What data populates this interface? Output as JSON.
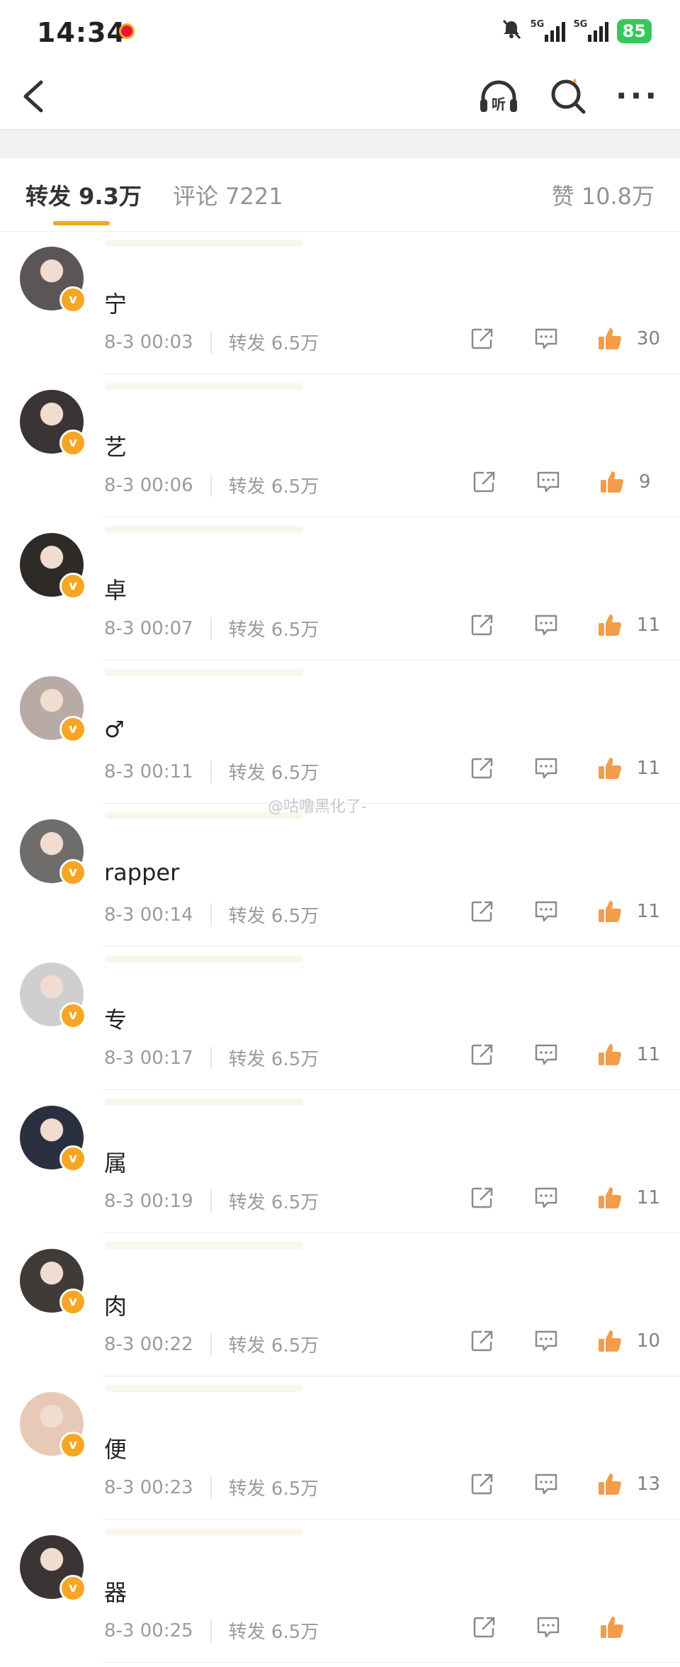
{
  "status": {
    "time": "14:34",
    "network1": "5G",
    "network2": "5G",
    "battery": "85"
  },
  "nav": {
    "listen_label": "听"
  },
  "tabs": [
    {
      "label": "转发 9.3万",
      "active": true
    },
    {
      "label": "评论 7221",
      "active": false
    },
    {
      "label": "赞 10.8万",
      "active": false
    }
  ],
  "watermark": "@咕噜黑化了-",
  "items": [
    {
      "content": "宁",
      "time": "8-3 00:03",
      "repost": "转发 6.5万",
      "likes": "30",
      "avatar_color": "#5b5558"
    },
    {
      "content": "艺",
      "time": "8-3 00:06",
      "repost": "转发 6.5万",
      "likes": "9",
      "avatar_color": "#3b3436"
    },
    {
      "content": "卓",
      "time": "8-3 00:07",
      "repost": "转发 6.5万",
      "likes": "11",
      "avatar_color": "#2e2a28"
    },
    {
      "content": "♂",
      "time": "8-3 00:11",
      "repost": "转发 6.5万",
      "likes": "11",
      "avatar_color": "#b8aaa4"
    },
    {
      "content": "rapper",
      "time": "8-3 00:14",
      "repost": "转发 6.5万",
      "likes": "11",
      "avatar_color": "#6f6c6c"
    },
    {
      "content": "专",
      "time": "8-3 00:17",
      "repost": "转发 6.5万",
      "likes": "11",
      "avatar_color": "#cfcfcf"
    },
    {
      "content": "属",
      "time": "8-3 00:19",
      "repost": "转发 6.5万",
      "likes": "11",
      "avatar_color": "#2b3040"
    },
    {
      "content": "肉",
      "time": "8-3 00:22",
      "repost": "转发 6.5万",
      "likes": "10",
      "avatar_color": "#403a38"
    },
    {
      "content": "便",
      "time": "8-3 00:23",
      "repost": "转发 6.5万",
      "likes": "13",
      "avatar_color": "#e8c9b8"
    },
    {
      "content": "器",
      "time": "8-3 00:25",
      "repost": "转发 6.5万",
      "likes": "",
      "avatar_color": "#3a3434"
    }
  ]
}
